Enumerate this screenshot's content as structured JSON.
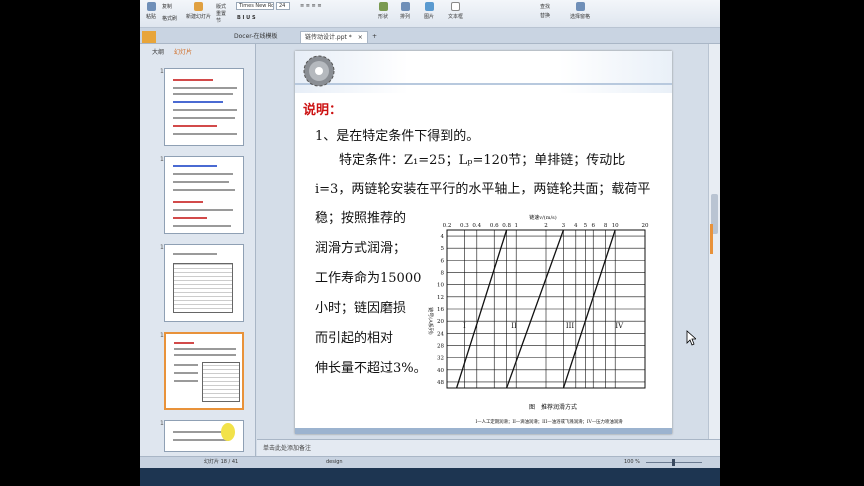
{
  "ribbon": {
    "paste_label": "粘贴",
    "copy_label": "复制",
    "format_painter_label": "格式刷",
    "new_slide_label": "新建幻灯片",
    "layout_label": "版式",
    "reset_label": "重置",
    "section_label": "节",
    "font_name": "Times New Ro",
    "font_size": "24",
    "shapes_label": "形状",
    "arrange_label": "排列",
    "picture_label": "图片",
    "textbox_label": "文本框",
    "find_label": "查找",
    "replace_label": "替换",
    "select_label": "选择窗格"
  },
  "tabs": [
    {
      "label": "Docer-在线模板"
    },
    {
      "label": "链传动设计.ppt *"
    }
  ],
  "left_pane": {
    "tab_outline": "大纲",
    "tab_slides": "幻灯片",
    "thumbnails": [
      {
        "number": "15"
      },
      {
        "number": "16"
      },
      {
        "number": "17"
      },
      {
        "number": "18"
      },
      {
        "number": "19"
      }
    ]
  },
  "slide": {
    "heading": "说明：",
    "line1": "1、是在特定条件下得到的。",
    "line2": "特定条件：Z₁=25；Lₚ=120节；单排链；传动比",
    "line3": "i=3，两链轮安装在平行的水平轴上，两链轮共面；载荷平",
    "line4": "稳；按照推荐的",
    "line5": "润滑方式润滑；",
    "line6": "工作寿命为15000",
    "line7": "小时；链因磨损",
    "line8": "而引起的相对",
    "line9": "伸长量不超过3%。"
  },
  "chart_data": {
    "type": "line",
    "title": "图　推荐润滑方式",
    "xlabel": "链速v/(m/s)",
    "ylabel": "链号(A系列)",
    "x_ticks": [
      "0.2",
      "0.3",
      "0.4",
      "0.6",
      "0.8",
      "1",
      "2",
      "3",
      "4",
      "5",
      "6",
      "8",
      "10",
      "20"
    ],
    "y_ticks": [
      "4",
      "5",
      "6",
      "8",
      "10",
      "12",
      "16",
      "20",
      "24",
      "28",
      "32",
      "40",
      "48"
    ],
    "regions": [
      "I",
      "II",
      "III",
      "IV"
    ],
    "caption": "I—人工定期润滑；II—滴油润滑；III—油浴或飞溅润滑；IV—压力喷油润滑"
  },
  "notes": {
    "placeholder": "单击此处添加备注"
  },
  "statusbar": {
    "slide_indicator": "幻灯片 18 / 41",
    "theme": "design",
    "zoom": "100 %"
  }
}
